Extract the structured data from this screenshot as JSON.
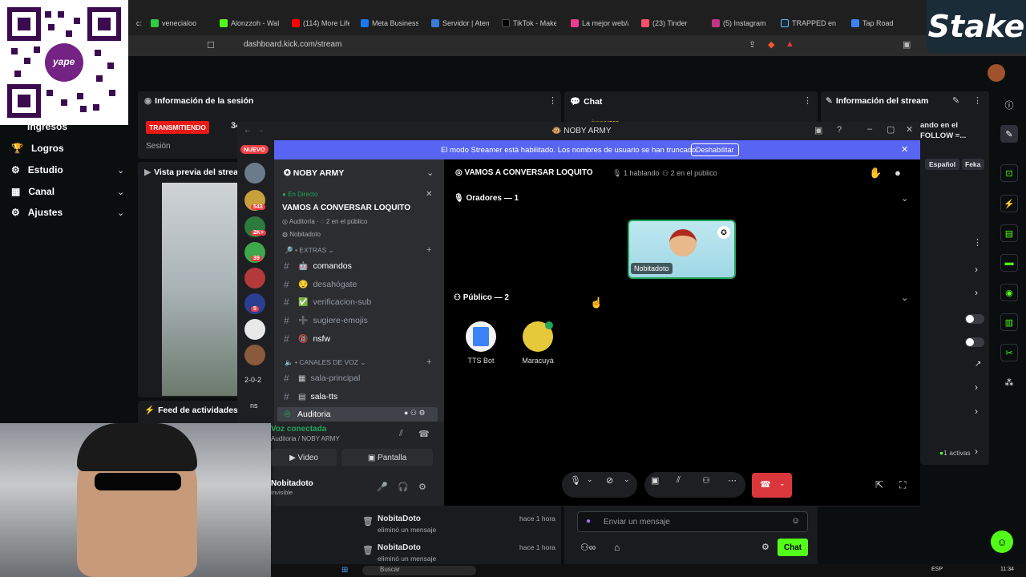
{
  "browser": {
    "tabs": [
      {
        "label": "c:",
        "color": "#444444"
      },
      {
        "label": "venecialoo",
        "color": "#2ecc40"
      },
      {
        "label": "Alonzzoh - Wal",
        "color": "#53fc18"
      },
      {
        "label": "(114) More Life",
        "color": "#ff0000"
      },
      {
        "label": "Meta Business",
        "color": "#1877f2"
      },
      {
        "label": "Servidor | Atem",
        "color": "#3a7bd5"
      },
      {
        "label": "TikTok - Make",
        "color": "#000000"
      },
      {
        "label": "La mejor web/a",
        "color": "#e83e8c"
      },
      {
        "label": "(23) Tinder",
        "color": "#fd5068"
      },
      {
        "label": "(5) Instagram",
        "color": "#c13584"
      },
      {
        "label": "TRAPPED en St",
        "color": "#1b2838"
      },
      {
        "label": "Tap Road",
        "color": "#3b82f6"
      }
    ],
    "url": "dashboard.kick.com/stream"
  },
  "overlay": {
    "stake_logo": "Stake",
    "qr_label": "yape"
  },
  "kick": {
    "nav": {
      "items": [
        {
          "label": "Ingresos"
        },
        {
          "label": "Logros"
        },
        {
          "label": "Estudio"
        },
        {
          "label": "Canal"
        },
        {
          "label": "Ajustes"
        }
      ]
    },
    "session_panel": {
      "title": "Información de la sesión",
      "live_badge": "TRANSMITIENDO",
      "session_label": "Sesión",
      "stat_partial": "34"
    },
    "preview_panel": {
      "title": "Vista previa del stream"
    },
    "feed_panel": {
      "title": "Feed de actividades",
      "rows": [
        {
          "user": "NobitaDoto",
          "action": "eliminó un mensaje",
          "time": "hace 1 hora"
        },
        {
          "user": "NobitaDoto",
          "action": "eliminó un mensaje",
          "time": "hace 1 hora"
        }
      ]
    },
    "chat_panel": {
      "title": "Chat",
      "input_placeholder": "Enviar un mensaje",
      "send_label": "Chat",
      "partial_user": "juuuvara"
    },
    "stream_info_panel": {
      "title": "Información del stream",
      "partial_text_1": "ando en el",
      "partial_text_2": "FOLLOW =...",
      "tags": [
        "Español",
        "Feka"
      ],
      "active_count": "1 activas"
    }
  },
  "discord": {
    "window_title": "NOBY ARMY",
    "streamer_notice": "El modo Streamer está habilitado. Los nombres de usuario se han truncado.",
    "disable_label": "Deshabilitar",
    "server_name": "NOBY ARMY",
    "badge_new": "NUEVO",
    "guild_badges": [
      "543",
      "2K+",
      "39",
      "5"
    ],
    "guild_text": "2-0-2",
    "guild_text2": "ns",
    "event": {
      "status": "En Directo",
      "title": "VAMOS A CONVERSAR LOQUITO",
      "meta_channel": "Auditoría",
      "meta_audience": "2 en el público",
      "host": "Nobitadoto"
    },
    "category_extras": "EXTRAS",
    "text_channels": [
      {
        "name": "comandos",
        "emoji": "🤖"
      },
      {
        "name": "desahógate",
        "emoji": "😌"
      },
      {
        "name": "verificacion-sub",
        "emoji": "✅"
      },
      {
        "name": "sugiere-emojis",
        "emoji": "➕"
      },
      {
        "name": "nsfw",
        "emoji": "🔞"
      }
    ],
    "category_voice": "CANALES DE VOZ",
    "voice_channels": [
      {
        "name": "sala-principal",
        "emoji": "▦"
      },
      {
        "name": "sala-tts",
        "emoji": "▤"
      }
    ],
    "stage_channel": "Auditoria",
    "voice_status": {
      "title": "Voz conectada",
      "location": "Auditoria / NOBY ARMY",
      "video_label": "Video",
      "screen_label": "Pantalla"
    },
    "user": {
      "name": "Nobitadoto",
      "status": "Invisible"
    },
    "stage": {
      "header_title": "VAMOS A CONVERSAR LOQUITO",
      "speaking": "1 hablando",
      "audience": "2 en el público",
      "speakers_label": "Oradores — 1",
      "speaker": {
        "name": "Nobitadoto"
      },
      "public_label": "Público — 2",
      "public": [
        {
          "name": "TTS Bot"
        },
        {
          "name": "Maracuyá"
        }
      ]
    }
  },
  "taskbar": {
    "search_placeholder": "Buscar",
    "lang": "ESP",
    "time": "11:34"
  }
}
